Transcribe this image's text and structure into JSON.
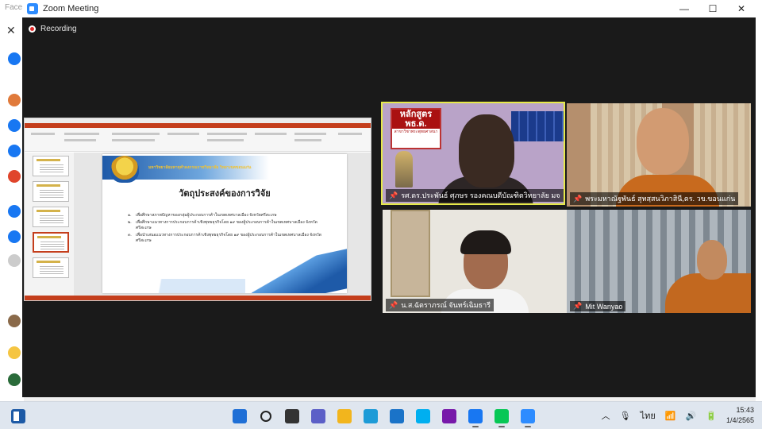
{
  "background": {
    "fb_title": "Face"
  },
  "window": {
    "title": "Zoom Meeting",
    "minimize": "—",
    "maximize": "☐",
    "close": "✕"
  },
  "recording": {
    "label": "Recording"
  },
  "shared_slide": {
    "university": "มหาวิทยาลัยมหาจุฬาลงกรณราชวิทยาลัย วิทยาเขตขอนแก่น",
    "title": "วัตถุประสงค์ของการวิจัย",
    "objectives": [
      {
        "num": "๑.",
        "text": "เพื่อศึกษาสภาพปัญหาของกลุ่มผู้ประกอบการค้าในเขตเทศบาลเมือง จังหวัดศรีสะเกษ"
      },
      {
        "num": "๒.",
        "text": "เพื่อศึกษาแนวทางการประกอบการค้าเชิงพุทธธุรกิจโดย ๑๙ ของผู้ประกอบการค้าในเขตเทศบาลเมือง จังหวัดศรีสะเกษ"
      },
      {
        "num": "๓.",
        "text": "เพื่อนำเสนอแนวทางการประกอบการค้าเชิงพุทธธุรกิจโดย ๑๙ ของผู้ประกอบการค้าในเขตเทศบาลเมือง จังหวัดศรีสะเกษ"
      }
    ]
  },
  "participants": [
    {
      "name": "รศ.ดร.ประพันธ์ ศุภษร รองคณบดีบัณฑิตวิทยาลัย มจร",
      "banner_big": "หลักสูตร พธ.ด.",
      "banner_small": "สาขาวิชาพระพุทธศาสนา"
    },
    {
      "name": "พระมหาณัฐพันธ์ สุทสฺสนวิภาสินี,ดร. วข.ขอนแก่น"
    },
    {
      "name": "น.ส.ฉัตราภรณ์ จันทร์เฉิมธารี"
    },
    {
      "name": "Mit Wanyao"
    }
  ],
  "taskbar": {
    "language": "ไทย",
    "time": "15:43",
    "date": "1/4/2565",
    "apps": [
      {
        "name": "start",
        "color": "#1f6fd6"
      },
      {
        "name": "search",
        "color": "#222222"
      },
      {
        "name": "task-view",
        "color": "#333333"
      },
      {
        "name": "chat",
        "color": "#5b5fc7"
      },
      {
        "name": "file-explorer",
        "color": "#f2b51d"
      },
      {
        "name": "edge",
        "color": "#1d9bd7"
      },
      {
        "name": "mail",
        "color": "#1a73c8"
      },
      {
        "name": "skype",
        "color": "#00aff0"
      },
      {
        "name": "onenote",
        "color": "#7719aa"
      },
      {
        "name": "facebook",
        "color": "#1877f2"
      },
      {
        "name": "line",
        "color": "#06c755"
      },
      {
        "name": "zoom",
        "color": "#2d8cff"
      }
    ]
  }
}
